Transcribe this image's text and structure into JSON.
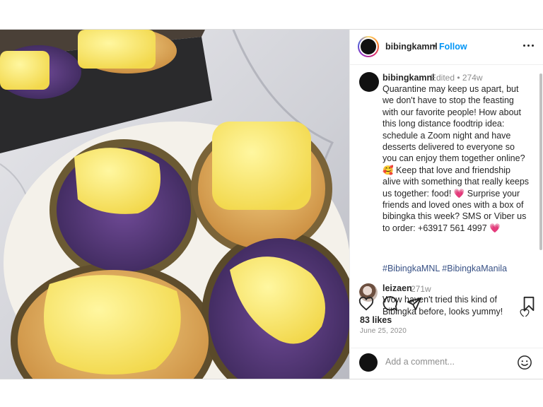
{
  "header": {
    "username": "bibingkamnl",
    "separator": "•",
    "follow_label": "Follow",
    "more_icon": "more-horizontal-icon"
  },
  "caption": {
    "username": "bibingkamnl",
    "edited": "Edited •  274w",
    "text": "Quarantine may keep us apart, but we don't have to stop the feasting with our favorite people! How about this long distance foodtrip idea: schedule a Zoom night and have desserts delivered to everyone so you can enjoy them together online? 🥰  Keep that love and friendship alive with something that really keeps us together: food! 💗 Surprise your friends and loved ones with a box of bibingka this week? SMS or Viber us to order: +63917 561 4997 💗",
    "hashtags": "#BibingkaMNL #BibingkaManila"
  },
  "comment": {
    "username": "leizaen",
    "time": "271w",
    "text": "Wow haven't tried this kind of Bibingka before, looks yummy!"
  },
  "actions": {
    "like_icon": "heart-icon",
    "comment_icon": "comment-icon",
    "share_icon": "send-icon",
    "save_icon": "bookmark-icon"
  },
  "likes": "83 likes",
  "date": "June 25, 2020",
  "add_comment": {
    "placeholder": "Add a comment...",
    "emoji_icon": "smiley-icon"
  },
  "colors": {
    "link_blue": "#0095f6",
    "hashtag_blue": "#385185",
    "muted": "#8e8e8e",
    "text": "#262626"
  }
}
